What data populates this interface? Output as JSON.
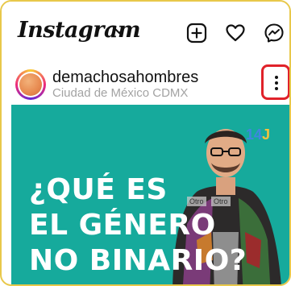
{
  "app": {
    "logo_text": "Instagram",
    "logo_icon": "chevron-down-icon"
  },
  "header_actions": [
    {
      "name": "new-post-icon"
    },
    {
      "name": "heart-icon"
    },
    {
      "name": "messenger-icon"
    }
  ],
  "post": {
    "username": "demachosahombres",
    "location": "Ciudad de México CDMX",
    "more_icon": "more-vertical-icon",
    "highlight_color": "#e0222a",
    "media": {
      "background": "#16aa9c",
      "headline": [
        "¿QUÉ ES",
        "EL GÉNERO",
        "NO BINARIO?"
      ],
      "tag_number": "14",
      "tag_symbol": "J",
      "stickers": [
        "Otro",
        "Otro"
      ]
    }
  }
}
